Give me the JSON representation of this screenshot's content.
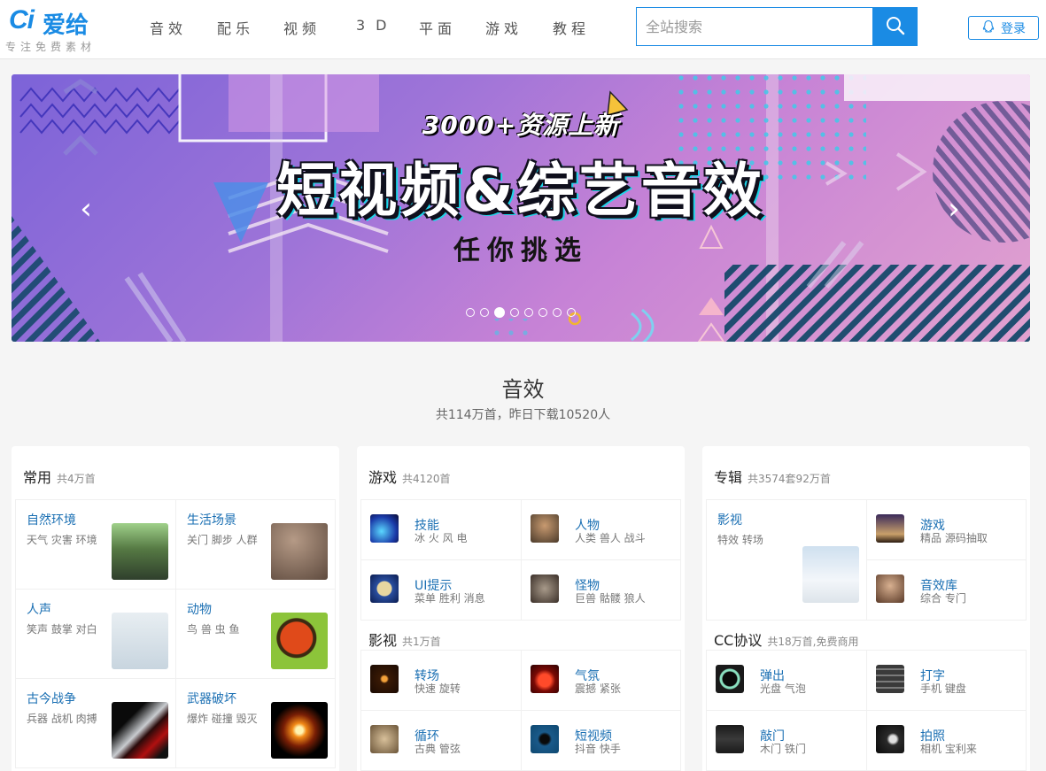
{
  "brand": {
    "logo_mark": "Ci",
    "logo_text": "爱给",
    "slogan": "专注免费素材"
  },
  "nav": {
    "items": [
      "音效",
      "配乐",
      "视频",
      "3D",
      "平面",
      "游戏",
      "教程"
    ]
  },
  "search": {
    "placeholder": "全站搜索",
    "value": ""
  },
  "login": {
    "label": "登录"
  },
  "banner": {
    "subtitle": "3000+资源上新",
    "title": "短视频&综艺音效",
    "tagline": "任你挑选",
    "prev": "‹",
    "next": "›",
    "slide_count": 8,
    "active_slide": 3
  },
  "section": {
    "title": "音效",
    "subtitle": "共114万首，昨日下载10520人"
  },
  "cards": {
    "common": {
      "title": "常用",
      "count": "共4万首",
      "tiles": [
        {
          "name": "自然环境",
          "tags": "天气 灾害 环境"
        },
        {
          "name": "生活场景",
          "tags": "关门 脚步 人群"
        },
        {
          "name": "人声",
          "tags": "笑声 鼓掌 对白"
        },
        {
          "name": "动物",
          "tags": "鸟 兽 虫 鱼"
        },
        {
          "name": "古今战争",
          "tags": "兵器 战机 肉搏"
        },
        {
          "name": "武器破坏",
          "tags": "爆炸 碰撞 毁灭"
        }
      ]
    },
    "game": {
      "title": "游戏",
      "count": "共4120首",
      "rows": [
        {
          "name": "技能",
          "tags": "冰 火 风 电"
        },
        {
          "name": "人物",
          "tags": "人类 兽人 战斗"
        },
        {
          "name": "UI提示",
          "tags": "菜单 胜利 消息"
        },
        {
          "name": "怪物",
          "tags": "巨兽 骷髅 狼人"
        }
      ],
      "sub_title": "影视",
      "sub_count": "共1万首",
      "sub_rows": [
        {
          "name": "转场",
          "tags": "快速 旋转"
        },
        {
          "name": "气氛",
          "tags": "震撼 紧张"
        },
        {
          "name": "循环",
          "tags": "古典 管弦"
        },
        {
          "name": "短视频",
          "tags": "抖音 快手"
        }
      ]
    },
    "album": {
      "title": "专辑",
      "count": "共3574套92万首",
      "feature": {
        "name": "影视",
        "tags": "特效 转场"
      },
      "rows": [
        {
          "name": "游戏",
          "tags": "精品 源码抽取"
        },
        {
          "name": "音效库",
          "tags": "综合 专门"
        }
      ],
      "sub_title": "CC协议",
      "sub_count": "共18万首,免费商用",
      "sub_rows": [
        {
          "name": "弹出",
          "tags": "光盘 气泡"
        },
        {
          "name": "打字",
          "tags": "手机 键盘"
        },
        {
          "name": "敲门",
          "tags": "木门 铁门"
        },
        {
          "name": "拍照",
          "tags": "相机 宝利来"
        }
      ]
    }
  },
  "colors": {
    "brand": "#1a8be4",
    "link": "#1a6fb3",
    "page_bg": "#f5f5f5"
  }
}
